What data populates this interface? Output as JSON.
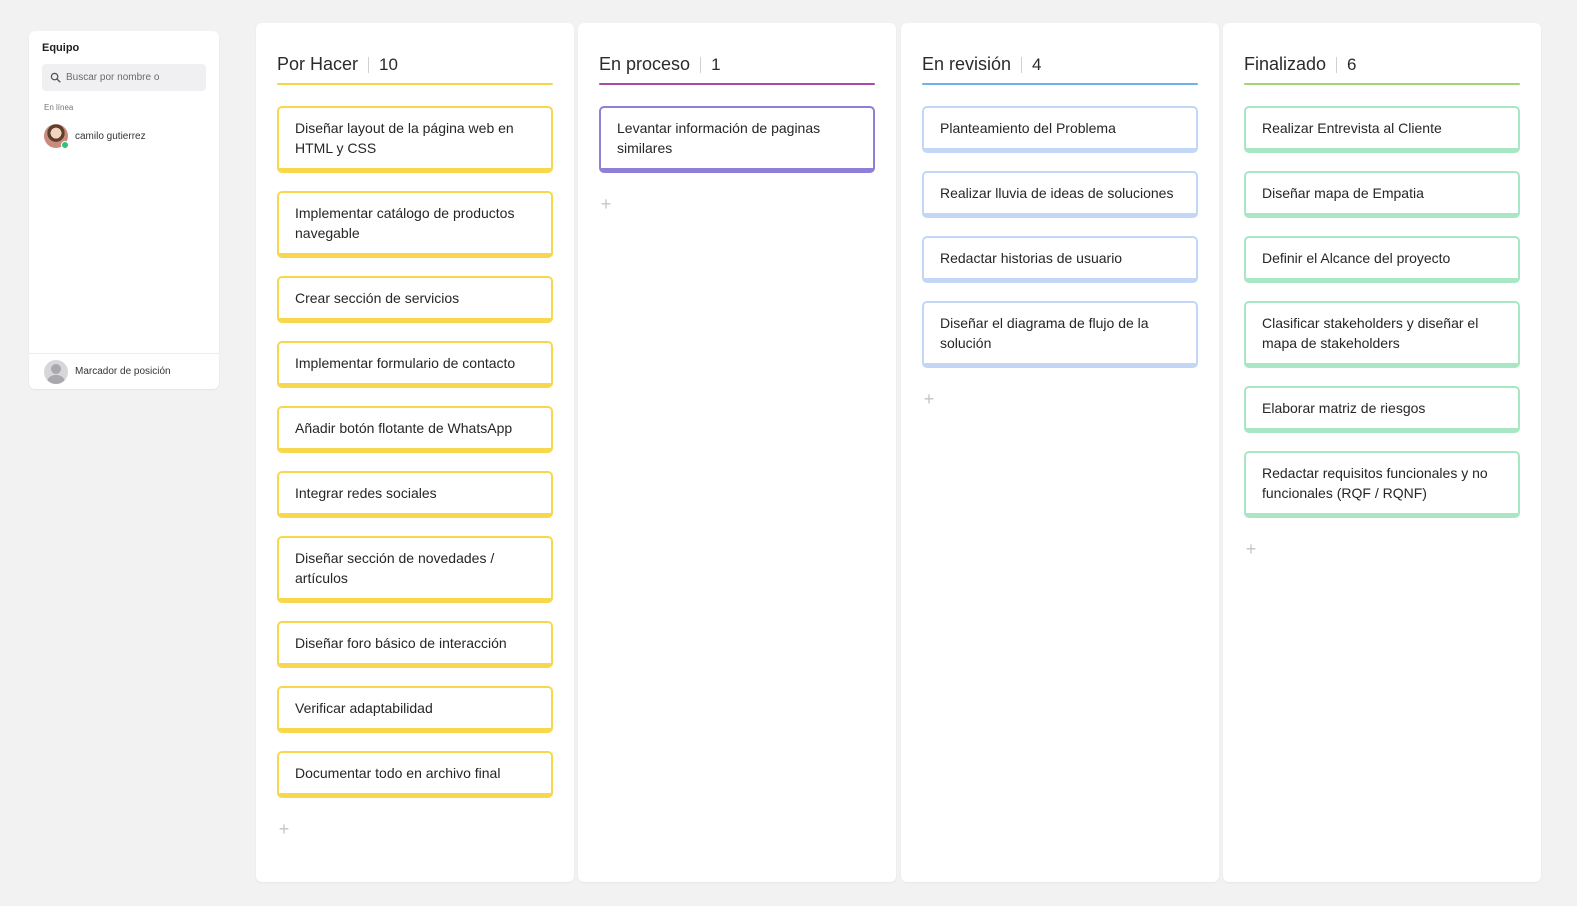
{
  "team": {
    "title": "Equipo",
    "search_placeholder": "Buscar por nombre o",
    "online_label": "En línea",
    "members": [
      {
        "name": "camilo gutierrez"
      }
    ],
    "footer_label": "Marcador de posición"
  },
  "board": {
    "columns": [
      {
        "title": "Por Hacer",
        "count": "10",
        "line_color": "#f5d64b",
        "card_border": "#f7d84c",
        "cards": [
          "Diseñar layout de la página web en HTML y CSS",
          "Implementar catálogo de productos navegable",
          "Crear sección de servicios",
          "Implementar formulario de contacto",
          "Añadir botón flotante de WhatsApp",
          "Integrar redes sociales",
          "Diseñar sección de novedades / artículos",
          "Diseñar foro básico de interacción",
          "Verificar adaptabilidad",
          "Documentar todo en archivo final"
        ]
      },
      {
        "title": "En proceso",
        "count": "1",
        "line_color": "#a64ca6",
        "card_border": "#8f7fd8",
        "cards": [
          "Levantar información de paginas similares"
        ]
      },
      {
        "title": "En revisión",
        "count": "4",
        "line_color": "#6fb1e8",
        "card_border": "#c3d6f5",
        "cards": [
          "Planteamiento del Problema",
          "Realizar lluvia de ideas de soluciones",
          "Redactar historias de usuario",
          "Diseñar el diagrama de flujo de la solución"
        ]
      },
      {
        "title": "Finalizado",
        "count": "6",
        "line_color": "#a3d47a",
        "card_border": "#a8e6c4",
        "cards": [
          "Realizar Entrevista al Cliente",
          "Diseñar mapa de Empatia",
          "Definir el Alcance del proyecto",
          "Clasificar stakeholders y diseñar el mapa de stakeholders",
          "Elaborar matriz de riesgos",
          "Redactar requisitos funcionales y no funcionales (RQF / RQNF)"
        ]
      }
    ],
    "add_symbol": "+"
  }
}
